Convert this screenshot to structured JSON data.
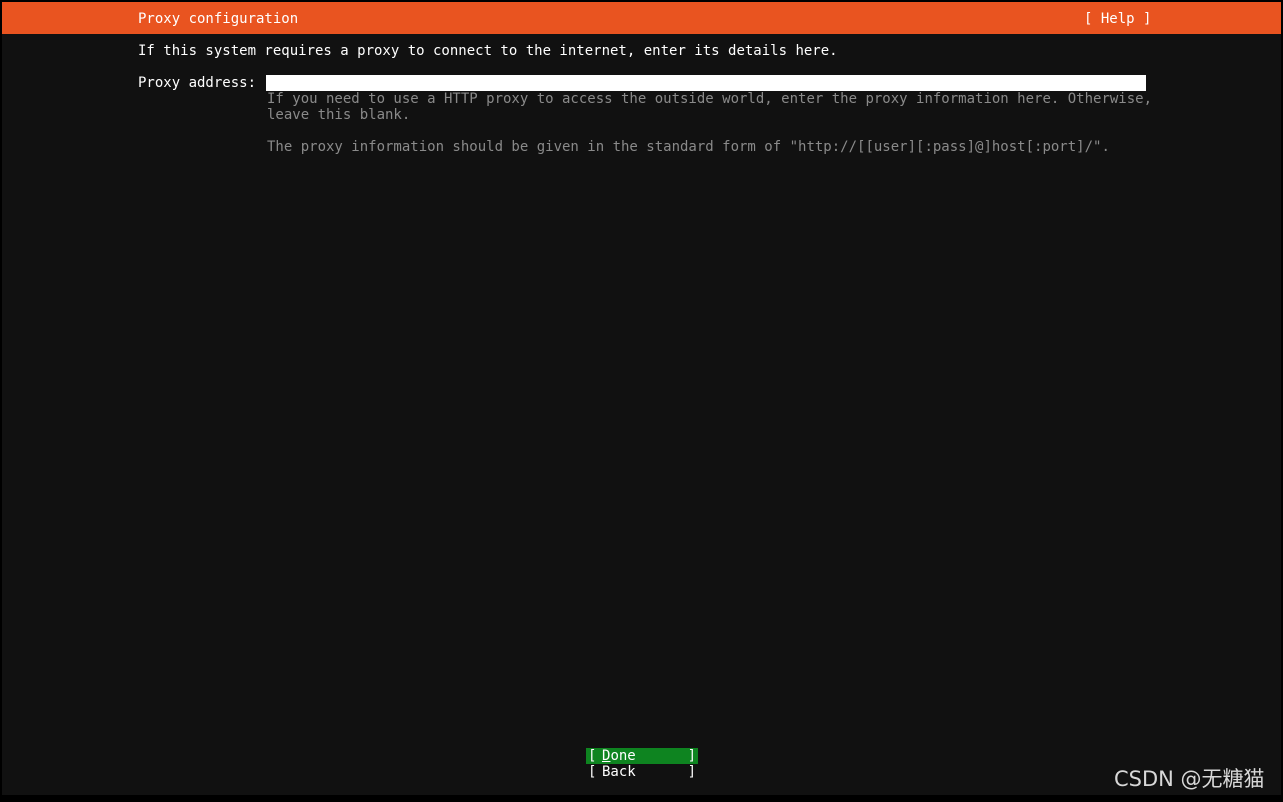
{
  "header": {
    "title": "Proxy configuration",
    "help_label": "[ Help ]",
    "accent_color": "#e95420"
  },
  "intro_text": "If this system requires a proxy to connect to the internet, enter its details here.",
  "proxy_field": {
    "label": "Proxy address:",
    "value": "",
    "help_line_1": "If you need to use a HTTP proxy to access the outside world, enter the proxy information here. Otherwise,",
    "help_line_2": "leave this blank.",
    "help_line_3": "The proxy information should be given in the standard form of \"http://[[user][:pass]@]host[:port]/\"."
  },
  "buttons": {
    "bracket_open": "[",
    "bracket_close": "]",
    "done_first": "D",
    "done_rest": "one",
    "back_label": "Back",
    "done_color": "#0e8420"
  },
  "watermark": "CSDN @无糖猫"
}
